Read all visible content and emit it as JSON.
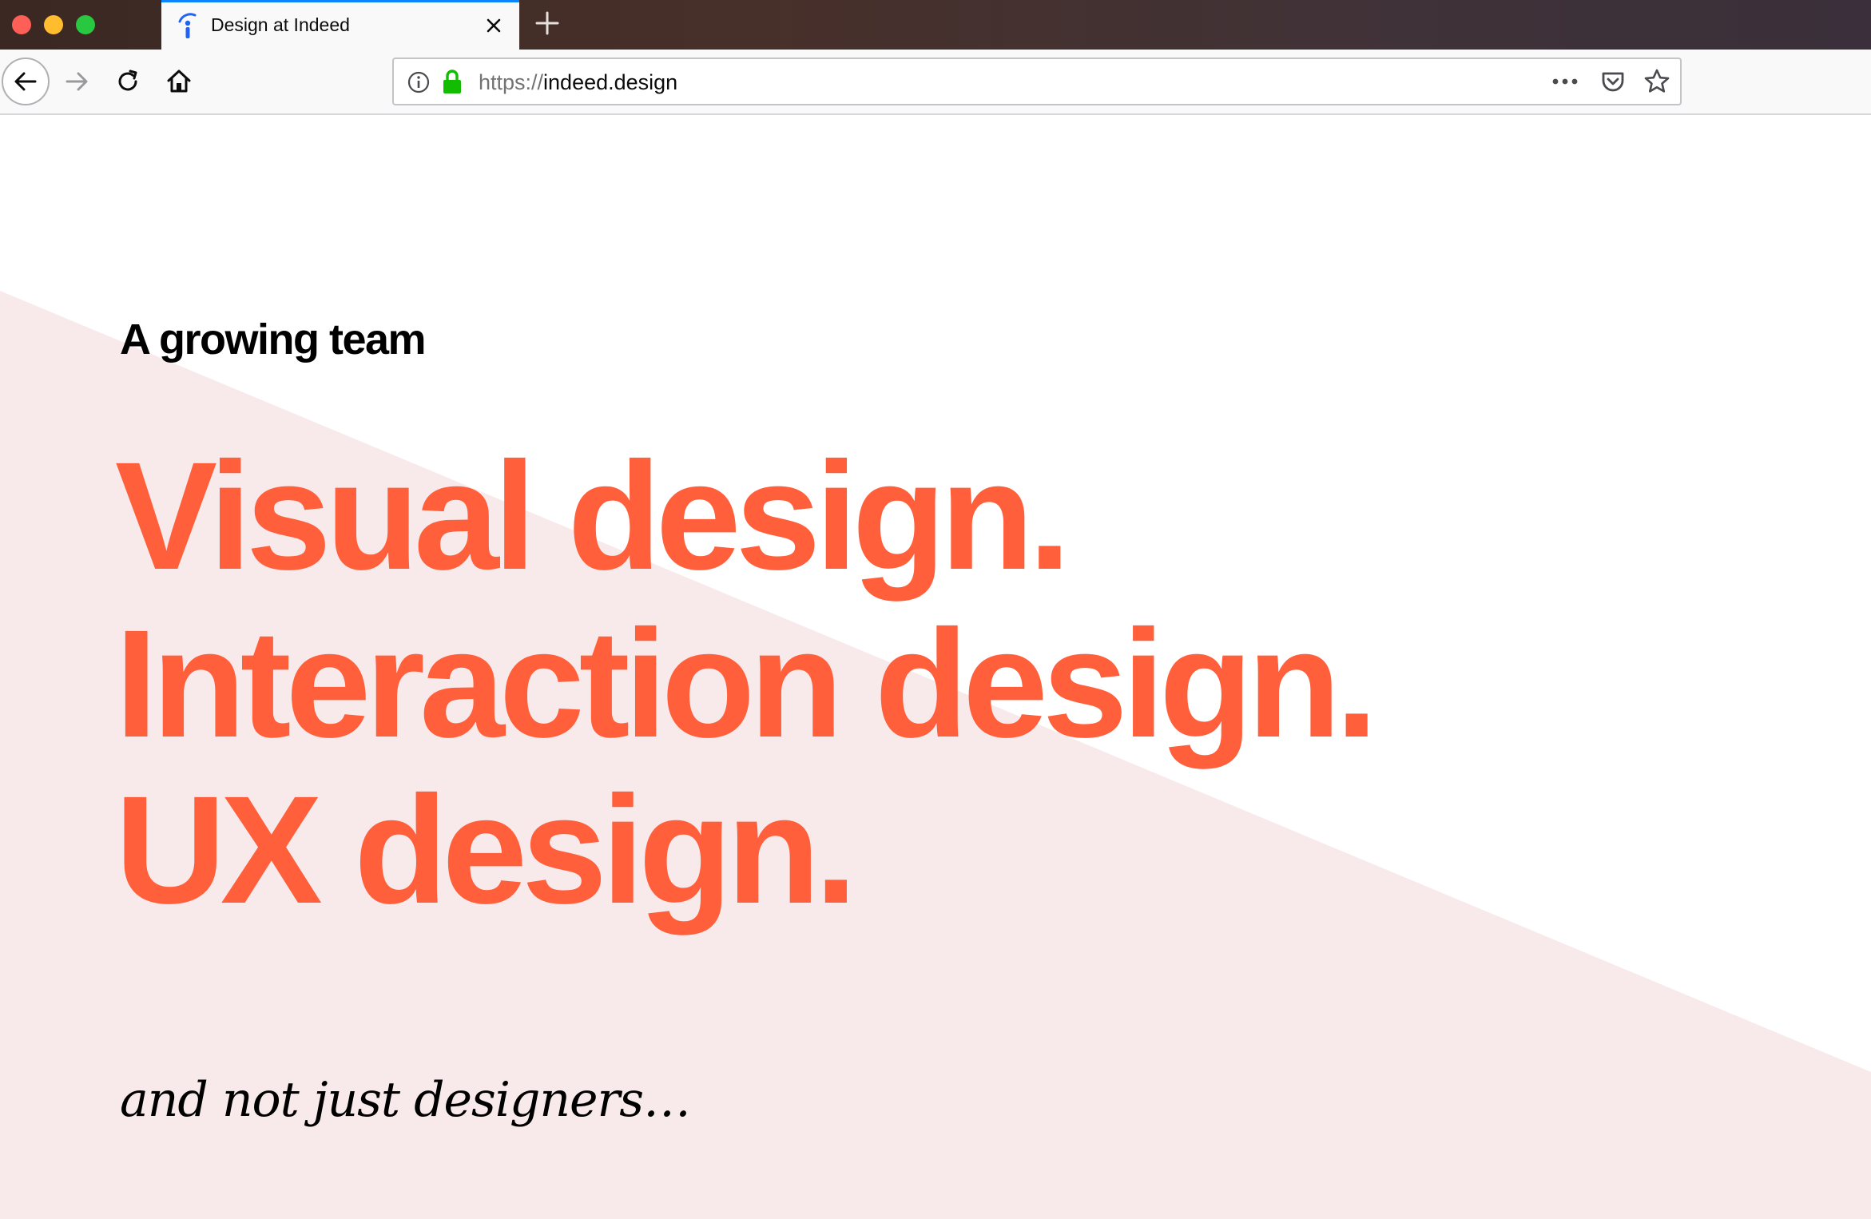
{
  "window": {
    "traffic_lights": [
      "close",
      "minimize",
      "zoom"
    ]
  },
  "tab": {
    "title": "Design at Indeed",
    "favicon": "indeed-logo-icon"
  },
  "toolbar": {
    "url_scheme": "https://",
    "url_host": "indeed.design",
    "icons": [
      "back-arrow-icon",
      "forward-arrow-icon",
      "reload-icon",
      "home-icon",
      "info-icon",
      "lock-icon",
      "more-dots-icon",
      "pocket-icon",
      "star-icon"
    ]
  },
  "page": {
    "eyebrow": "A growing team",
    "headline": [
      "Visual design.",
      "Interaction design.",
      "UX design."
    ],
    "tagline": "and not just designers…"
  },
  "colors": {
    "accent": "#ff5f3a",
    "background_shape": "#f8eaea",
    "tab_highlight": "#0a84ff",
    "lock_green": "#12bc00"
  }
}
